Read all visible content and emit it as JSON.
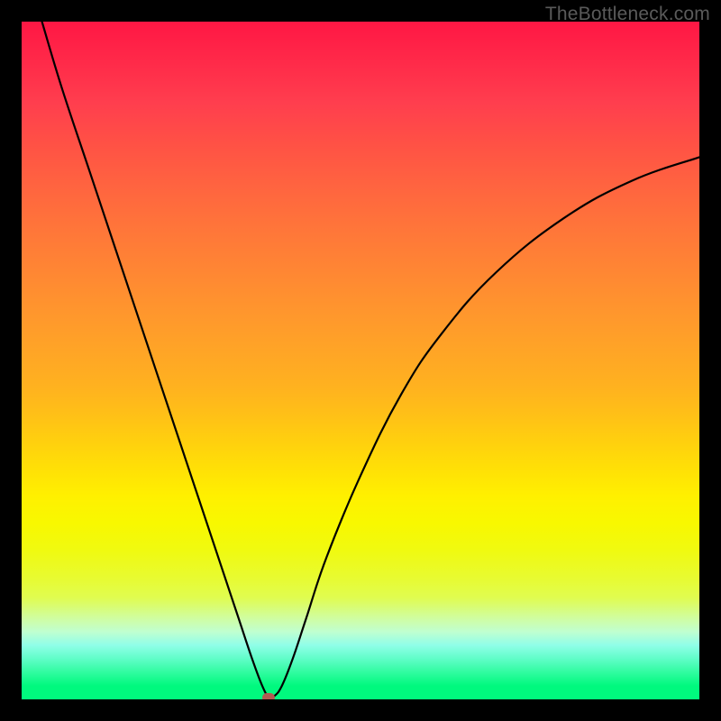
{
  "watermark": "TheBottleneck.com",
  "colors": {
    "background": "#000000",
    "curve": "#000000",
    "marker": "#b15b52"
  },
  "chart_data": {
    "type": "line",
    "title": "",
    "xlabel": "",
    "ylabel": "",
    "xlim": [
      0,
      100
    ],
    "ylim": [
      0,
      100
    ],
    "series": [
      {
        "name": "bottleneck-curve",
        "x": [
          3,
          6,
          10,
          14,
          18,
          22,
          26,
          30,
          32,
          34,
          35.5,
          36.5,
          37.3,
          38.4,
          40,
          42,
          45,
          50,
          56,
          62,
          70,
          80,
          90,
          100
        ],
        "y": [
          100,
          90,
          78,
          66,
          54,
          42,
          30,
          18,
          12,
          6,
          2,
          0.3,
          0.5,
          2,
          6,
          12,
          21,
          33,
          45,
          54,
          63,
          71,
          76.5,
          80
        ]
      }
    ],
    "marker": {
      "x": 36.5,
      "y": 0.3
    },
    "background_gradient": {
      "top": "#ff1744",
      "mid": "#fff000",
      "bottom": "#00f97e"
    }
  }
}
